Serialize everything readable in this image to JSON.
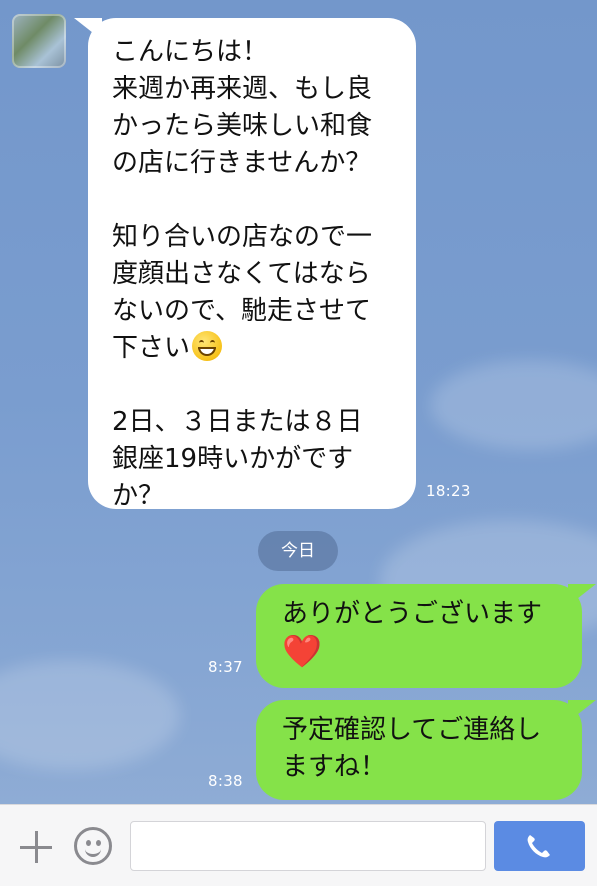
{
  "messages": {
    "incoming": {
      "text_before_emoji": "こんにちは！\n来週か再来週、もし良\nかったら美味しい和食\nの店に行きませんか？\n\n知り合いの店なので一\n度顔出さなくてはなら\nないので、馳走させて\n下さい",
      "emoji": "grinning-face",
      "text_after_emoji": "\n\n2日、３日または８日\n銀座19時いかがです\nか？",
      "time": "18:23"
    },
    "date_separator": "今日",
    "outgoing": [
      {
        "text": "ありがとうございます\n",
        "heart": "❤️",
        "time": "8:37"
      },
      {
        "text": "予定確認してご連絡し\nますね！",
        "time": "8:38"
      }
    ]
  },
  "input_bar": {
    "plus_icon": "plus-icon",
    "sticker_icon": "smiley-icon",
    "placeholder": "",
    "call_icon": "phone-icon"
  },
  "colors": {
    "background": "#7a9dcf",
    "outgoing_bubble": "#85e249",
    "incoming_bubble": "#ffffff",
    "call_button": "#5b8be3"
  }
}
